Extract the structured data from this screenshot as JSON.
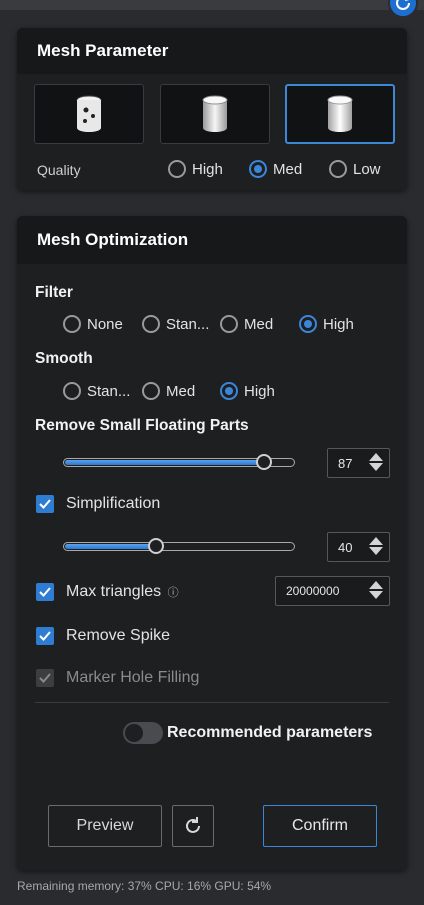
{
  "mesh_parameter": {
    "title": "Mesh Parameter",
    "quality_label": "Quality",
    "quality_options": [
      "High",
      "Med",
      "Low"
    ],
    "quality_selected": "Med"
  },
  "mesh_optimization": {
    "title": "Mesh Optimization",
    "filter": {
      "label": "Filter",
      "options": [
        "None",
        "Stan...",
        "Med",
        "High"
      ],
      "selected": "High"
    },
    "smooth": {
      "label": "Smooth",
      "options": [
        "Stan...",
        "Med",
        "High"
      ],
      "selected": "High"
    },
    "remove_small_floating_parts": {
      "label": "Remove Small Floating Parts",
      "value": "87",
      "slider_fraction": 0.87
    },
    "simplification": {
      "label": "Simplification",
      "checked": true,
      "value": "40",
      "slider_fraction": 0.4
    },
    "max_triangles": {
      "label": "Max triangles",
      "info_icon": "ⓘ",
      "checked": true,
      "value": "20000000"
    },
    "remove_spike": {
      "label": "Remove Spike",
      "checked": true
    },
    "marker_hole_filling": {
      "label": "Marker Hole Filling",
      "checked": true,
      "disabled": true
    },
    "recommended_parameters": {
      "label": "Recommended parameters",
      "on": false
    },
    "buttons": {
      "preview": "Preview",
      "confirm": "Confirm"
    }
  },
  "status_bar": {
    "text": "Remaining memory: 37% CPU: 16% GPU: 54%"
  },
  "colors": {
    "accent": "#3b86d8",
    "panel": "#1e1f21",
    "header": "#17181a",
    "background": "#2a2b2e"
  },
  "icons": [
    "refresh-icon",
    "cylinder-holes-icon",
    "cylinder-icon",
    "cylinder-smooth-icon",
    "checkmark-icon",
    "info-icon"
  ]
}
